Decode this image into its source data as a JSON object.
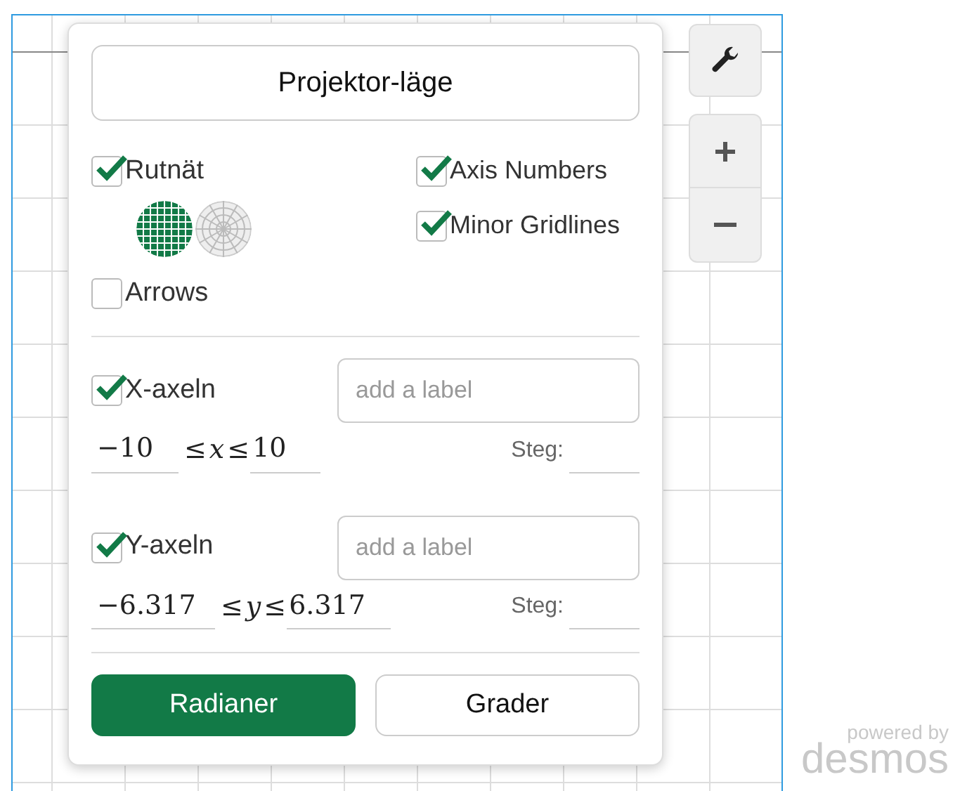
{
  "settings_panel": {
    "projector_mode": {
      "label": "Projektor-läge"
    },
    "grid": {
      "label": "Rutnät",
      "checked": true,
      "grid_types": [
        {
          "kind": "cartesian",
          "selected": true
        },
        {
          "kind": "polar",
          "selected": false
        }
      ]
    },
    "axis_numbers": {
      "label": "Axis Numbers",
      "checked": true
    },
    "minor_gridlines": {
      "label": "Minor Gridlines",
      "checked": true
    },
    "arrows": {
      "label": "Arrows",
      "checked": false
    },
    "axes": [
      {
        "label": "X-axeln",
        "checked": true,
        "placeholder": "add a label",
        "min": "−10",
        "relation_left": "≤",
        "variable": "x",
        "relation_right": "≤",
        "max": "10",
        "step_label": "Steg:"
      },
      {
        "label": "Y-axeln",
        "checked": true,
        "placeholder": "add a label",
        "min": "−6.317",
        "relation_left": "≤",
        "variable": "y",
        "relation_right": "≤",
        "max": "6.317",
        "step_label": "Steg:"
      }
    ],
    "angle_units": [
      {
        "label": "Radianer",
        "selected": true
      },
      {
        "label": "Grader",
        "selected": false
      }
    ]
  },
  "branding": {
    "line_1": "powered by",
    "line_2": "desmos"
  }
}
